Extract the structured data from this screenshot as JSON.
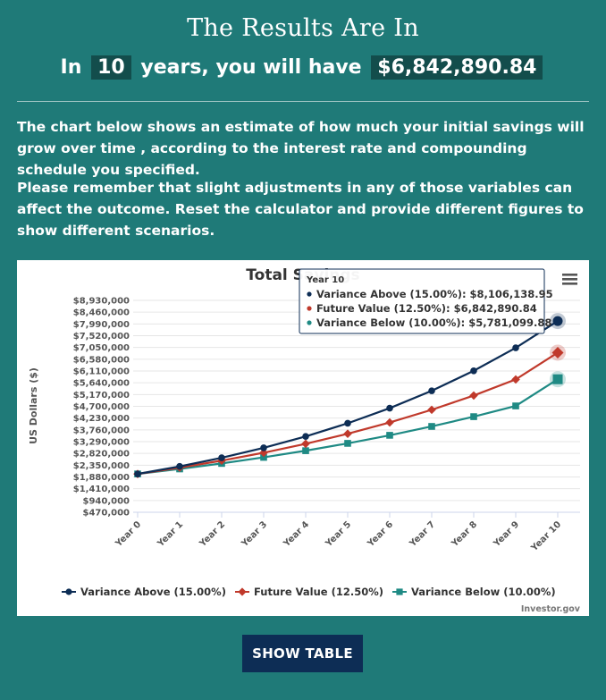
{
  "header": {
    "title": "The Results Are In",
    "prefix": "In",
    "years": "10",
    "middle": "years, you will have",
    "amount": "$6,842,890.84"
  },
  "paragraphs": [
    "The chart below shows an estimate of how much your initial savings will grow over time , according to the interest rate and compounding schedule you specified.",
    "Please remember that slight adjustments in any of those variables can affect the outcome. Reset the calculator and provide different figures to show different scenarios."
  ],
  "buttons": {
    "show_table": "SHOW TABLE"
  },
  "chart_data": {
    "type": "line",
    "title": "Total Savings",
    "ylabel": "US Dollars ($)",
    "xlabel": "",
    "categories": [
      "Year 0",
      "Year 1",
      "Year 2",
      "Year 3",
      "Year 4",
      "Year 5",
      "Year 6",
      "Year 7",
      "Year 8",
      "Year 9",
      "Year 10"
    ],
    "ylim": [
      470000,
      8930000
    ],
    "yticks": [
      "$470,000",
      "$940,000",
      "$1,410,000",
      "$1,880,000",
      "$2,350,000",
      "$2,820,000",
      "$3,290,000",
      "$3,760,000",
      "$4,230,000",
      "$4,700,000",
      "$5,170,000",
      "$5,640,000",
      "$6,110,000",
      "$6,580,000",
      "$7,050,000",
      "$7,520,000",
      "$7,990,000",
      "$8,460,000",
      "$8,930,000"
    ],
    "grid": true,
    "legend_position": "bottom",
    "credit": "Investor.gov",
    "series": [
      {
        "name": "Variance Above (15.00%)",
        "color": "#0d2d55",
        "marker": "circle",
        "values": [
          2000000,
          2300000,
          2645000,
          3041750,
          3498013,
          4022714,
          4626121,
          5320039,
          6118045,
          7035752,
          8106139
        ]
      },
      {
        "name": "Future Value (12.50%)",
        "color": "#c0392b",
        "marker": "diamond",
        "values": [
          2000000,
          2250000,
          2531250,
          2847656,
          3203613,
          3604065,
          4054573,
          4561395,
          5131570,
          5773016,
          6842891
        ]
      },
      {
        "name": "Variance Below (10.00%)",
        "color": "#1f8a84",
        "marker": "square",
        "values": [
          2000000,
          2200000,
          2420000,
          2662000,
          2928200,
          3221020,
          3543122,
          3897434,
          4287178,
          4715895,
          5781100
        ]
      }
    ],
    "tooltip": {
      "header": "Year 10",
      "lines": [
        "Variance Above (15.00%): $8,106,138.95",
        "Future Value (12.50%): $6,842,890.84",
        "Variance Below (10.00%): $5,781,099.88"
      ]
    }
  }
}
